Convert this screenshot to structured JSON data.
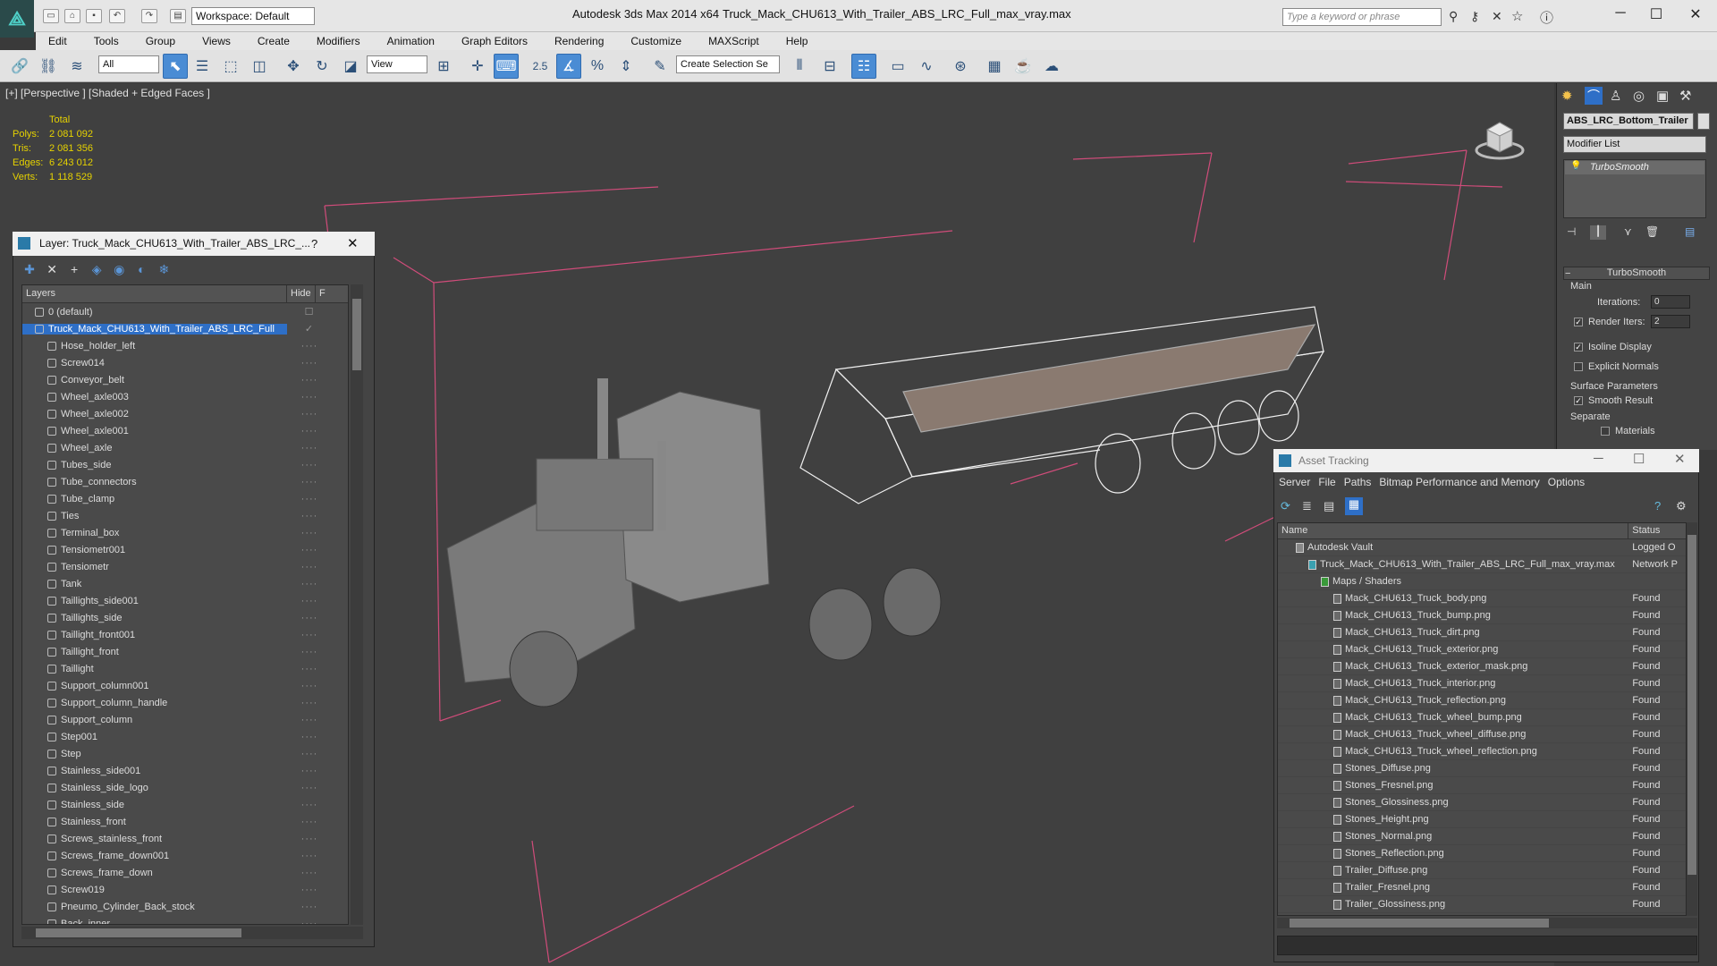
{
  "titlebar": {
    "app_title": "Autodesk 3ds Max  2014 x64",
    "file_title": "Truck_Mack_CHU613_With_Trailer_ABS_LRC_Full_max_vray.max",
    "workspace": "Workspace: Default",
    "search_placeholder": "Type a keyword or phrase"
  },
  "menu": [
    "Edit",
    "Tools",
    "Group",
    "Views",
    "Create",
    "Modifiers",
    "Animation",
    "Graph Editors",
    "Rendering",
    "Customize",
    "MAXScript",
    "Help"
  ],
  "toolbar": {
    "filter_select": "All",
    "view_select": "View",
    "selection_set": "Create Selection Se",
    "snap_label": "2.5"
  },
  "viewport": {
    "label": "[+] [Perspective ] [Shaded + Edged Faces ]",
    "stats": {
      "total_label": "Total",
      "polys_label": "Polys:",
      "polys": "2 081 092",
      "tris_label": "Tris:",
      "tris": "2 081 356",
      "edges_label": "Edges:",
      "edges": "6 243 012",
      "verts_label": "Verts:",
      "verts": "1 118 529"
    }
  },
  "layer_panel": {
    "title": "Layer: Truck_Mack_CHU613_With_Trailer_ABS_LRC_...",
    "help": "?",
    "close": "✕",
    "col_layers": "Layers",
    "col_hide": "Hide",
    "col_f": "F",
    "layers": [
      {
        "name": "0 (default)",
        "level": 1,
        "type": "layer"
      },
      {
        "name": "Truck_Mack_CHU613_With_Trailer_ABS_LRC_Full",
        "level": 1,
        "type": "layer",
        "selected": true
      },
      {
        "name": "Hose_holder_left",
        "level": 2,
        "type": "obj"
      },
      {
        "name": "Screw014",
        "level": 2,
        "type": "obj"
      },
      {
        "name": "Conveyor_belt",
        "level": 2,
        "type": "obj"
      },
      {
        "name": "Wheel_axle003",
        "level": 2,
        "type": "obj"
      },
      {
        "name": "Wheel_axle002",
        "level": 2,
        "type": "obj"
      },
      {
        "name": "Wheel_axle001",
        "level": 2,
        "type": "obj"
      },
      {
        "name": "Wheel_axle",
        "level": 2,
        "type": "obj"
      },
      {
        "name": "Tubes_side",
        "level": 2,
        "type": "obj"
      },
      {
        "name": "Tube_connectors",
        "level": 2,
        "type": "obj"
      },
      {
        "name": "Tube_clamp",
        "level": 2,
        "type": "obj"
      },
      {
        "name": "Ties",
        "level": 2,
        "type": "obj"
      },
      {
        "name": "Terminal_box",
        "level": 2,
        "type": "obj"
      },
      {
        "name": "Tensiometr001",
        "level": 2,
        "type": "obj"
      },
      {
        "name": "Tensiometr",
        "level": 2,
        "type": "obj"
      },
      {
        "name": "Tank",
        "level": 2,
        "type": "obj"
      },
      {
        "name": "Taillights_side001",
        "level": 2,
        "type": "obj"
      },
      {
        "name": "Taillights_side",
        "level": 2,
        "type": "obj"
      },
      {
        "name": "Taillight_front001",
        "level": 2,
        "type": "obj"
      },
      {
        "name": "Taillight_front",
        "level": 2,
        "type": "obj"
      },
      {
        "name": "Taillight",
        "level": 2,
        "type": "obj"
      },
      {
        "name": "Support_column001",
        "level": 2,
        "type": "obj"
      },
      {
        "name": "Support_column_handle",
        "level": 2,
        "type": "obj"
      },
      {
        "name": "Support_column",
        "level": 2,
        "type": "obj"
      },
      {
        "name": "Step001",
        "level": 2,
        "type": "obj"
      },
      {
        "name": "Step",
        "level": 2,
        "type": "obj"
      },
      {
        "name": "Stainless_side001",
        "level": 2,
        "type": "obj"
      },
      {
        "name": "Stainless_side_logo",
        "level": 2,
        "type": "obj"
      },
      {
        "name": "Stainless_side",
        "level": 2,
        "type": "obj"
      },
      {
        "name": "Stainless_front",
        "level": 2,
        "type": "obj"
      },
      {
        "name": "Screws_stainless_front",
        "level": 2,
        "type": "obj"
      },
      {
        "name": "Screws_frame_down001",
        "level": 2,
        "type": "obj"
      },
      {
        "name": "Screws_frame_down",
        "level": 2,
        "type": "obj"
      },
      {
        "name": "Screw019",
        "level": 2,
        "type": "obj"
      },
      {
        "name": "Pneumo_Cylinder_Back_stock",
        "level": 2,
        "type": "obj"
      },
      {
        "name": "Back_inner",
        "level": 2,
        "type": "obj"
      }
    ]
  },
  "command_panel": {
    "object_name": "ABS_LRC_Bottom_Trailer",
    "modifier_list": "Modifier List",
    "stack_item": "TurboSmooth",
    "rollout_title": "TurboSmooth",
    "main_label": "Main",
    "iterations_label": "Iterations:",
    "iterations": "0",
    "render_iters_label": "Render Iters:",
    "render_iters": "2",
    "isoline": "Isoline Display",
    "explicit_normals": "Explicit Normals",
    "surface_params": "Surface Parameters",
    "smooth_result": "Smooth Result",
    "separate": "Separate",
    "materials": "Materials"
  },
  "asset_panel": {
    "title": "Asset Tracking",
    "menu": [
      "Server",
      "File",
      "Paths",
      "Bitmap Performance and Memory",
      "Options"
    ],
    "col_name": "Name",
    "col_status": "Status",
    "rows": [
      {
        "name": "Autodesk Vault",
        "status": "Logged O",
        "level": 0,
        "icon": "vault"
      },
      {
        "name": "Truck_Mack_CHU613_With_Trailer_ABS_LRC_Full_max_vray.max",
        "status": "Network P",
        "level": 1,
        "icon": "max"
      },
      {
        "name": "Maps / Shaders",
        "status": "",
        "level": 2,
        "icon": "maps"
      },
      {
        "name": "Mack_CHU613_Truck_body.png",
        "status": "Found",
        "level": 3,
        "icon": "file"
      },
      {
        "name": "Mack_CHU613_Truck_bump.png",
        "status": "Found",
        "level": 3,
        "icon": "file"
      },
      {
        "name": "Mack_CHU613_Truck_dirt.png",
        "status": "Found",
        "level": 3,
        "icon": "file"
      },
      {
        "name": "Mack_CHU613_Truck_exterior.png",
        "status": "Found",
        "level": 3,
        "icon": "file"
      },
      {
        "name": "Mack_CHU613_Truck_exterior_mask.png",
        "status": "Found",
        "level": 3,
        "icon": "file"
      },
      {
        "name": "Mack_CHU613_Truck_interior.png",
        "status": "Found",
        "level": 3,
        "icon": "file"
      },
      {
        "name": "Mack_CHU613_Truck_reflection.png",
        "status": "Found",
        "level": 3,
        "icon": "file"
      },
      {
        "name": "Mack_CHU613_Truck_wheel_bump.png",
        "status": "Found",
        "level": 3,
        "icon": "file"
      },
      {
        "name": "Mack_CHU613_Truck_wheel_diffuse.png",
        "status": "Found",
        "level": 3,
        "icon": "file"
      },
      {
        "name": "Mack_CHU613_Truck_wheel_reflection.png",
        "status": "Found",
        "level": 3,
        "icon": "file"
      },
      {
        "name": "Stones_Diffuse.png",
        "status": "Found",
        "level": 3,
        "icon": "file"
      },
      {
        "name": "Stones_Fresnel.png",
        "status": "Found",
        "level": 3,
        "icon": "file"
      },
      {
        "name": "Stones_Glossiness.png",
        "status": "Found",
        "level": 3,
        "icon": "file"
      },
      {
        "name": "Stones_Height.png",
        "status": "Found",
        "level": 3,
        "icon": "file"
      },
      {
        "name": "Stones_Normal.png",
        "status": "Found",
        "level": 3,
        "icon": "file"
      },
      {
        "name": "Stones_Reflection.png",
        "status": "Found",
        "level": 3,
        "icon": "file"
      },
      {
        "name": "Trailer_Diffuse.png",
        "status": "Found",
        "level": 3,
        "icon": "file"
      },
      {
        "name": "Trailer_Fresnel.png",
        "status": "Found",
        "level": 3,
        "icon": "file"
      },
      {
        "name": "Trailer_Glossiness.png",
        "status": "Found",
        "level": 3,
        "icon": "file"
      }
    ]
  },
  "colors": {
    "selection": "#2e6fc7",
    "stats_text": "#e6d200",
    "viewport_bg": "#404040",
    "grid_lines": "#d04c7a"
  }
}
